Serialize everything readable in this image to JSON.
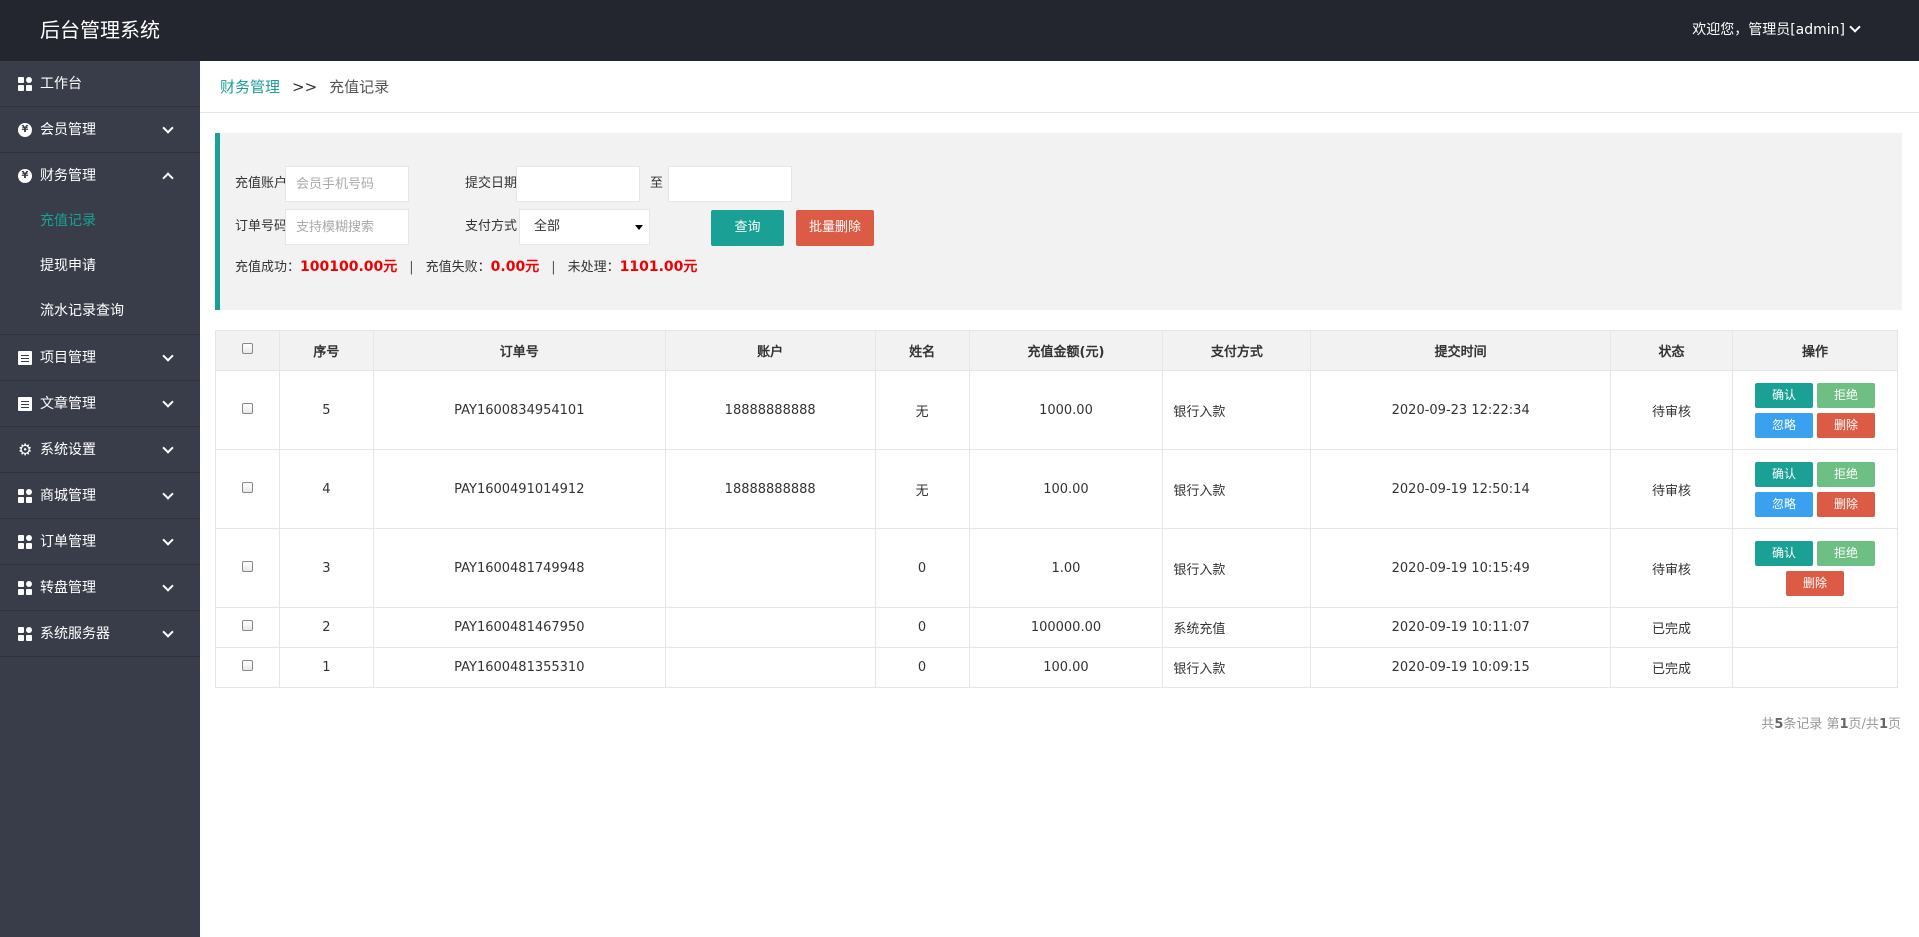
{
  "header": {
    "app_title": "后台管理系统",
    "user_text": "欢迎您，管理员[admin]"
  },
  "sidebar": {
    "items": [
      {
        "label": "工作台",
        "icon": "grid-icon"
      },
      {
        "label": "会员管理",
        "icon": "yen-circle-icon"
      },
      {
        "label": "财务管理",
        "icon": "yen-circle-icon"
      },
      {
        "label": "项目管理",
        "icon": "document-icon"
      },
      {
        "label": "文章管理",
        "icon": "document-icon"
      },
      {
        "label": "系统设置",
        "icon": "gear-icon"
      },
      {
        "label": "商城管理",
        "icon": "grid-icon"
      },
      {
        "label": "订单管理",
        "icon": "grid-icon"
      },
      {
        "label": "转盘管理",
        "icon": "grid-icon"
      },
      {
        "label": "系统服务器",
        "icon": "grid-icon"
      }
    ],
    "finance_sub": [
      {
        "label": "充值记录",
        "active": true
      },
      {
        "label": "提现申请",
        "active": false
      },
      {
        "label": "流水记录查询",
        "active": false
      }
    ]
  },
  "breadcrumb": {
    "parent": "财务管理",
    "separator": ">>",
    "current": "充值记录"
  },
  "filter": {
    "account_label": "充值账户",
    "account_placeholder": "会员手机号码",
    "date_label": "提交日期",
    "date_to": "至",
    "order_label": "订单号码",
    "order_placeholder": "支持模糊搜索",
    "pay_label": "支付方式",
    "pay_selected": "全部",
    "query_button": "查询",
    "batch_delete_button": "批量删除"
  },
  "stats": {
    "success_label": "充值成功：",
    "success_value": "100100.00元",
    "fail_label": "充值失败：",
    "fail_value": "0.00元",
    "pending_label": "未处理：",
    "pending_value": "1101.00元",
    "divider": "|"
  },
  "table": {
    "headers": [
      "序号",
      "订单号",
      "账户",
      "姓名",
      "充值金额(元)",
      "支付方式",
      "提交时间",
      "状态",
      "操作"
    ],
    "rows": [
      {
        "no": "5",
        "order": "PAY1600834954101",
        "account": "18888888888",
        "name": "无",
        "amount": "1000.00",
        "pay": "银行入款",
        "time": "2020-09-23 12:22:34",
        "status": "待审核"
      },
      {
        "no": "4",
        "order": "PAY1600491014912",
        "account": "18888888888",
        "name": "无",
        "amount": "100.00",
        "pay": "银行入款",
        "time": "2020-09-19 12:50:14",
        "status": "待审核"
      },
      {
        "no": "3",
        "order": "PAY1600481749948",
        "account": "",
        "name": "0",
        "amount": "1.00",
        "pay": "银行入款",
        "time": "2020-09-19 10:15:49",
        "status": "待审核"
      },
      {
        "no": "2",
        "order": "PAY1600481467950",
        "account": "",
        "name": "0",
        "amount": "100000.00",
        "pay": "系统充值",
        "time": "2020-09-19 10:11:07",
        "status": "已完成"
      },
      {
        "no": "1",
        "order": "PAY1600481355310",
        "account": "",
        "name": "0",
        "amount": "100.00",
        "pay": "银行入款",
        "time": "2020-09-19 10:09:15",
        "status": "已完成"
      }
    ],
    "actions": {
      "confirm": "确认",
      "reject": "拒绝",
      "ignore": "忽略",
      "delete": "删除"
    }
  },
  "pager": {
    "prefix": "共",
    "total": "5",
    "mid1": "条记录 第",
    "page": "1",
    "mid2": "页/共",
    "pages": "1",
    "suffix": "页"
  },
  "colors": {
    "header_bg": "#23262e",
    "sidebar_bg": "#393d49",
    "accent": "#1aa094",
    "danger": "#dc5b45",
    "reject": "#6dbf83",
    "ignore": "#3aa0f0",
    "stat_value": "#ee0000"
  }
}
